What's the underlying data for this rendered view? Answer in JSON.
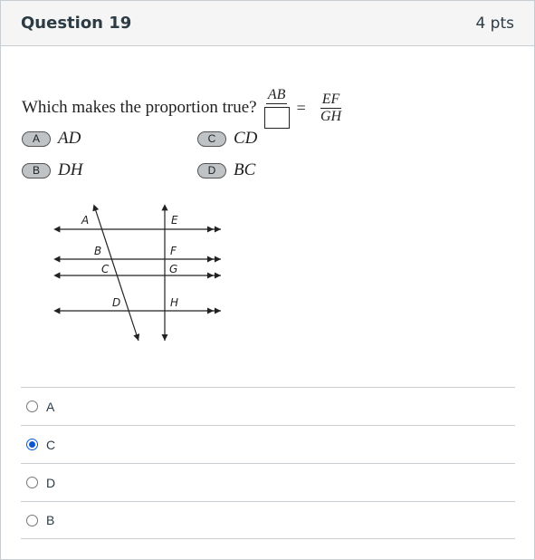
{
  "question": {
    "title": "Question 19",
    "points": "4 pts"
  },
  "prompt": {
    "text": "Which makes the proportion true?",
    "lhs_numerator": "AB",
    "equals": "=",
    "rhs_numerator": "EF",
    "rhs_denominator": "GH"
  },
  "image_choices": [
    {
      "letter": "A",
      "value": "AD"
    },
    {
      "letter": "C",
      "value": "CD"
    },
    {
      "letter": "B",
      "value": "DH"
    },
    {
      "letter": "D",
      "value": "BC"
    }
  ],
  "diagram_labels": {
    "a": "A",
    "b": "B",
    "c": "C",
    "d": "D",
    "e": "E",
    "f": "F",
    "g": "G",
    "h": "H"
  },
  "answers": [
    {
      "label": "A",
      "selected": false
    },
    {
      "label": "C",
      "selected": true
    },
    {
      "label": "D",
      "selected": false
    },
    {
      "label": "B",
      "selected": false
    }
  ],
  "colors": {
    "selected_radio": "#0b57d0",
    "header_bg": "#f5f5f5",
    "border": "#c7cdd1"
  }
}
